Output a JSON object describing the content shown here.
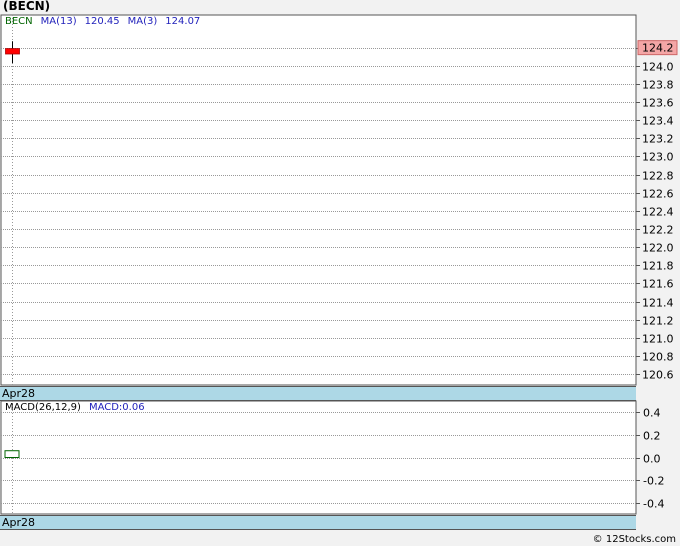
{
  "title": "(BECN)",
  "price_legend": {
    "ticker": "BECN",
    "ma13_label": "MA(13)",
    "ma13_value": "120.45",
    "ma3_label": "MA(3)",
    "ma3_value": "124.07"
  },
  "macd_legend": {
    "label": "MACD(26,12,9)",
    "value_label": "MACD:0.06"
  },
  "date_label": "Apr28",
  "footer": "© 12Stocks.com",
  "colors": {
    "candle_up": "#ff0000",
    "last_price_tag": "#f4a6a6",
    "macd_bar": "#006400",
    "datebar": "#add8e6"
  },
  "chart_data": [
    {
      "type": "candlestick",
      "title": "(BECN)",
      "y_ticks": [
        "124.2",
        "124.0",
        "123.8",
        "123.6",
        "123.4",
        "123.2",
        "123.0",
        "122.8",
        "122.6",
        "122.4",
        "122.2",
        "122.0",
        "121.8",
        "121.6",
        "121.4",
        "121.2",
        "121.0",
        "120.8",
        "120.6"
      ],
      "ylim": [
        120.48,
        124.56
      ],
      "x": [
        "Apr28"
      ],
      "candles": [
        {
          "date": "Apr28",
          "open": 124.13,
          "high": 124.27,
          "low": 124.03,
          "close": 124.19
        }
      ],
      "last_price": "124.2",
      "grid": true
    },
    {
      "type": "bar",
      "title": "MACD(26,12,9)",
      "y_ticks": [
        "0.4",
        "0.2",
        "0.0",
        "-0.2",
        "-0.4"
      ],
      "ylim": [
        -0.5,
        0.5
      ],
      "x": [
        "Apr28"
      ],
      "series": [
        {
          "name": "MACD",
          "values": [
            0.06
          ]
        }
      ],
      "grid": true
    }
  ]
}
